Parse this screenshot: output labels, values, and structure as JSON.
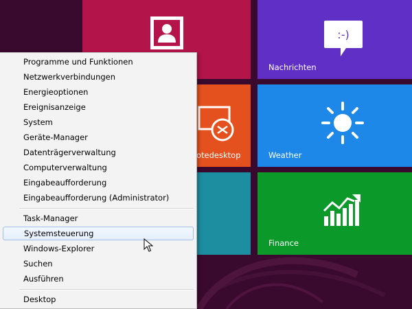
{
  "colors": {
    "background": "#3a0a2e",
    "people_tile": "#b3144a",
    "messages_tile": "#5f2fc6",
    "remote_tile": "#e5511e",
    "weather_tile": "#1d88e8",
    "teal_tile": "#1d8e9f",
    "finance_tile": "#0b9a2a",
    "menu_background": "#f3f3f3",
    "highlight_border": "#9fbfe6"
  },
  "tiles": {
    "people": {
      "label": "",
      "icon": "person-icon"
    },
    "messages": {
      "label": "Nachrichten",
      "icon": "chat-bubble-smiley-icon",
      "icon_text": ":-)"
    },
    "remote_desktop": {
      "label": "otedesktop",
      "icon": "remote-desktop-icon"
    },
    "weather": {
      "label": "Weather",
      "icon": "sun-icon"
    },
    "teal": {
      "label": "",
      "icon": ""
    },
    "finance": {
      "label": "Finance",
      "icon": "finance-chart-icon"
    }
  },
  "context_menu": {
    "group1": [
      "Programme und Funktionen",
      "Netzwerkverbindungen",
      "Energieoptionen",
      "Ereignisanzeige",
      "System",
      "Geräte-Manager",
      "Datenträgerverwaltung",
      "Computerverwaltung",
      "Eingabeaufforderung",
      "Eingabeaufforderung (Administrator)"
    ],
    "group2": [
      "Task-Manager",
      "Systemsteuerung",
      "Windows-Explorer",
      "Suchen",
      "Ausführen"
    ],
    "group3": [
      "Desktop"
    ],
    "highlighted_item": "Systemsteuerung"
  }
}
